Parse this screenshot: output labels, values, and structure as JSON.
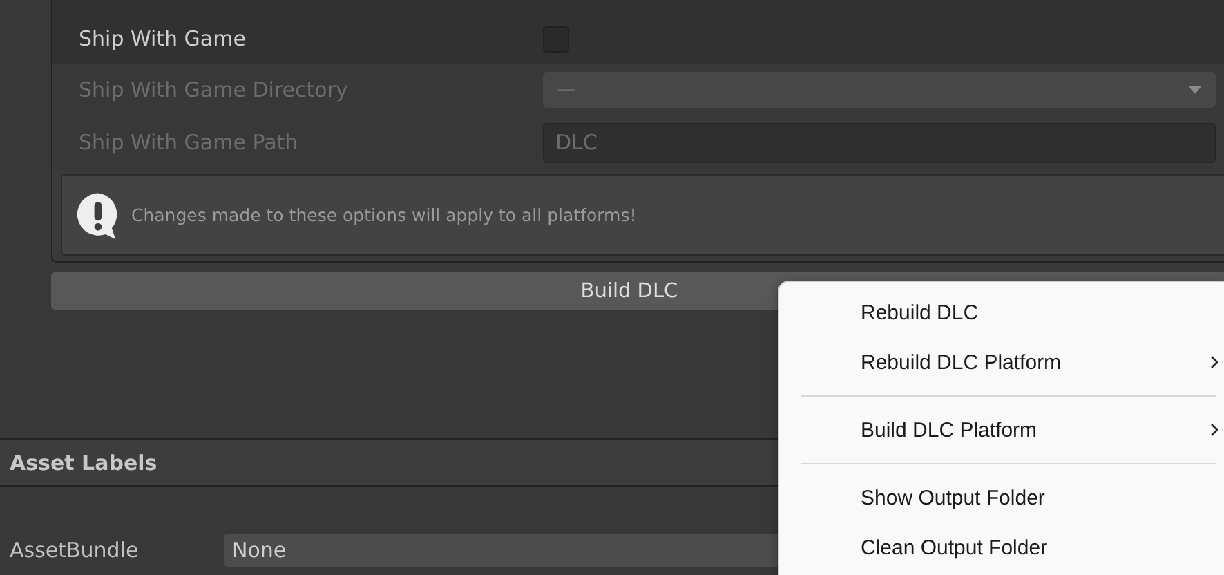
{
  "inspector": {
    "rows": [
      {
        "kind": "checkbox",
        "label": "Ship With Game",
        "checked": false,
        "disabled": false
      },
      {
        "kind": "dropdown",
        "label": "Ship With Game Directory",
        "value": "—",
        "disabled": true
      },
      {
        "kind": "text",
        "label": "Ship With Game Path",
        "value": "DLC",
        "disabled": true
      }
    ],
    "info": "Changes made to these options will apply to all platforms!"
  },
  "build_button": "Build DLC",
  "asset_labels": {
    "title": "Asset Labels",
    "asset_bundle": {
      "label": "AssetBundle",
      "value": "None"
    }
  },
  "context_menu": {
    "items": [
      {
        "kind": "item",
        "label": "Rebuild DLC",
        "submenu": false
      },
      {
        "kind": "item",
        "label": "Rebuild DLC Platform",
        "submenu": true
      },
      {
        "kind": "separator"
      },
      {
        "kind": "item",
        "label": "Build DLC Platform",
        "submenu": true
      },
      {
        "kind": "separator"
      },
      {
        "kind": "item",
        "label": "Show Output Folder",
        "submenu": false
      },
      {
        "kind": "item",
        "label": "Clean Output Folder",
        "submenu": false
      }
    ]
  }
}
